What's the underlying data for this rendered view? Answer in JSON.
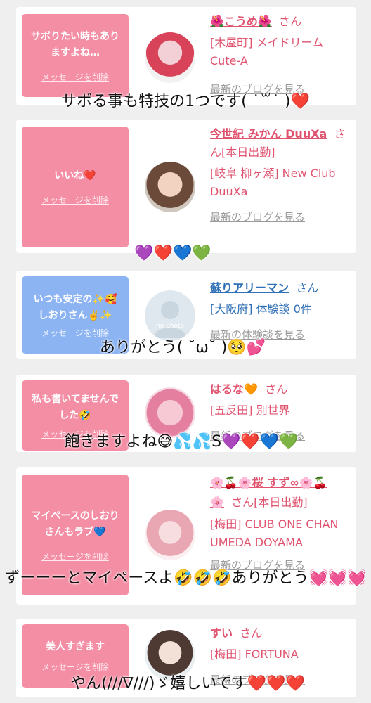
{
  "cards": [
    {
      "message": "サボりたい時もありますよね…",
      "delete_label": "メッセージを削除",
      "name": "🌺こうめ🌺",
      "san": "さん",
      "shop": "[木屋町] メイドリーム Cute-A",
      "blog": "最新のブログを見る",
      "overlay": "サボる事も特技の1つです( ˙꒳˙ )❤️"
    },
    {
      "message": "いいね❤️",
      "delete_label": "メッセージを削除",
      "name": "今世紀 みかん DuuXa",
      "san": "さん[本日出勤]",
      "shop": "[岐阜 柳ヶ瀬] New Club DuuXa",
      "blog": "最新のブログを見る",
      "overlay": "💜❤️💙💚"
    },
    {
      "message": "いつも安定の✨🥰しおりさん✌️✨",
      "delete_label": "メッセージを削除",
      "name": "蘇りアリーマン",
      "san": "さん",
      "shop": "[大阪府] 体験談 0件",
      "blog": "最新の体験談を見る",
      "avatar_text": "no photo",
      "overlay": "ありがとう( ˘ω˘ )🥺💕"
    },
    {
      "message": "私も書いてませんでした🤣",
      "delete_label": "メッセージを削除",
      "name": "はるな🧡",
      "san": "さん",
      "shop": "[五反田] 別世界",
      "blog": "最新のブログを見る",
      "overlay": "飽きますよね😅💦💦S💜❤️💙💚"
    },
    {
      "message": "マイペースのしおりさんもラブ💙",
      "delete_label": "メッセージを削除",
      "name": "🌸🍒🌸桜 すず∞🌸🍒🌸",
      "san": "さん[本日出勤]",
      "shop": "[梅田] CLUB ONE CHAN UMEDA DOYAMA",
      "blog": "最新のブログを見る",
      "overlay": "ずーーーとマイペースよ🤣🤣🤣ありがとう💓💓💓"
    },
    {
      "message": "美人すぎます",
      "delete_label": "メッセージを削除",
      "name": "すい",
      "san": "さん",
      "shop": "[梅田] FORTUNA",
      "blog": "最新のブログを見る",
      "overlay": "やん(///∇///)ゞ嬉しいです❤️❤️❤️"
    }
  ],
  "colors": {
    "accent_pink": "#f48ea5",
    "accent_blue": "#8cb4f3",
    "link_pink": "#e0536f",
    "link_blue": "#2f6fb6"
  }
}
